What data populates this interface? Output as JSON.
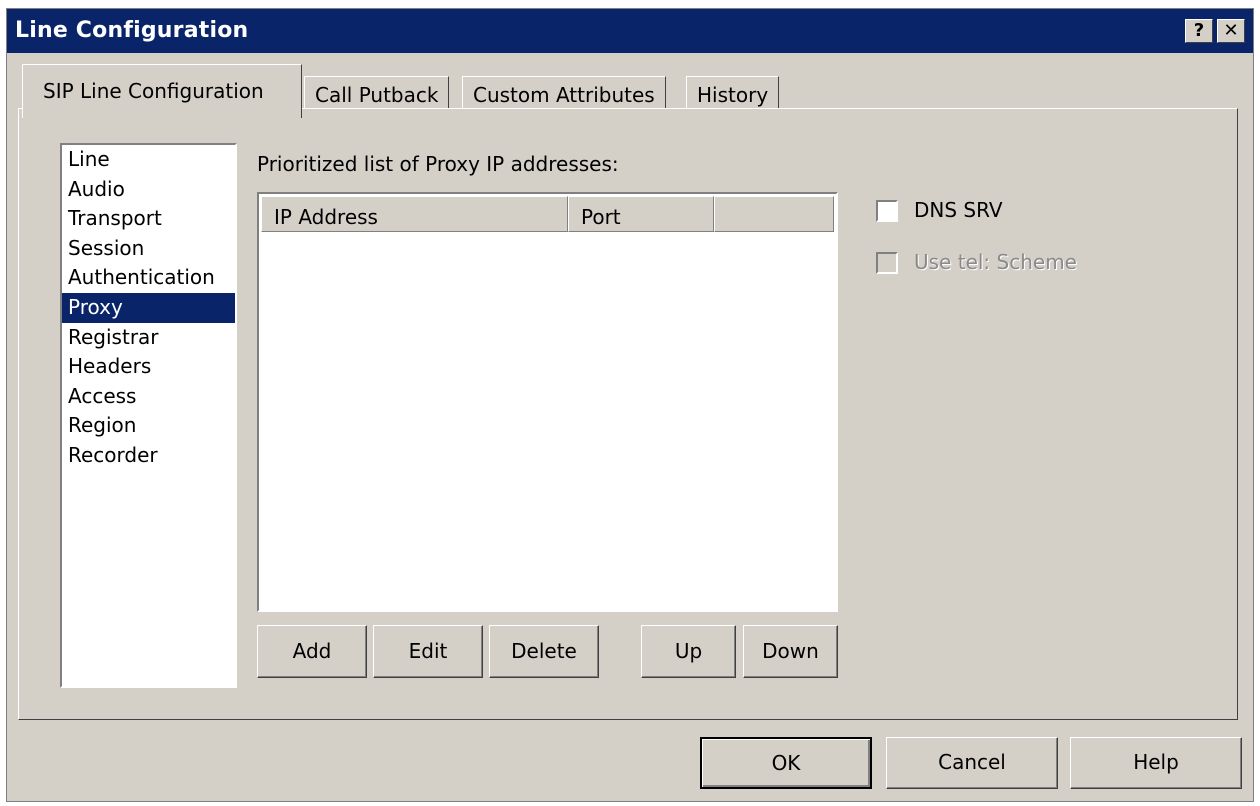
{
  "window": {
    "title": "Line Configuration",
    "help_label": "?",
    "close_label": "✕"
  },
  "tabs": [
    {
      "label": "SIP Line Configuration",
      "active": true
    },
    {
      "label": "Call Putback",
      "active": false
    },
    {
      "label": "Custom Attributes",
      "active": false
    },
    {
      "label": "History",
      "active": false
    }
  ],
  "nav": {
    "items": [
      "Line",
      "Audio",
      "Transport",
      "Session",
      "Authentication",
      "Proxy",
      "Registrar",
      "Headers",
      "Access",
      "Region",
      "Recorder"
    ],
    "selected": "Proxy"
  },
  "proxy": {
    "list_label": "Prioritized list of Proxy IP addresses:",
    "columns": [
      "IP Address",
      "Port",
      ""
    ],
    "rows": [],
    "buttons": {
      "add": "Add",
      "edit": "Edit",
      "delete": "Delete",
      "up": "Up",
      "down": "Down"
    }
  },
  "options": {
    "dns_srv": {
      "label": "DNS SRV",
      "checked": false,
      "enabled": true
    },
    "use_tel": {
      "label": "Use tel: Scheme",
      "checked": false,
      "enabled": false
    }
  },
  "footer": {
    "ok": "OK",
    "cancel": "Cancel",
    "help": "Help"
  },
  "colors": {
    "titlebar": "#0a246a",
    "face": "#d4d0c8",
    "selection": "#0a246a"
  }
}
